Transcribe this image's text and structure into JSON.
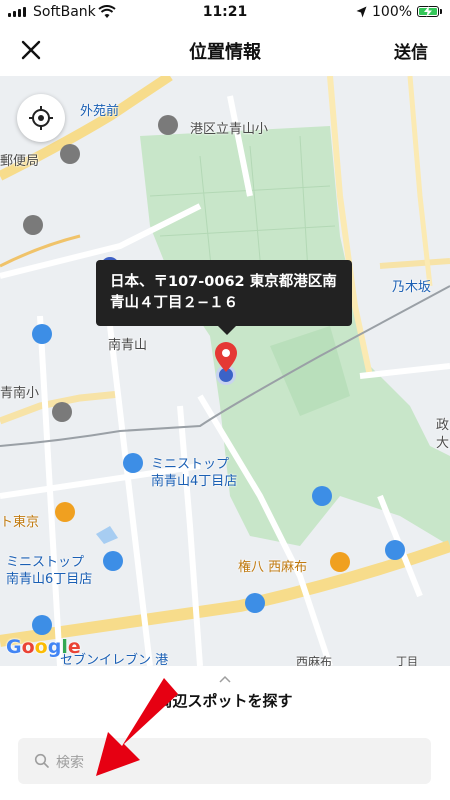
{
  "status_bar": {
    "carrier": "SoftBank",
    "time": "11:21",
    "battery": "100%"
  },
  "header": {
    "title": "位置情報",
    "send_label": "送信"
  },
  "map": {
    "address_callout": "日本、〒107-0062 東京都港区南青山４丁目２−１６",
    "labels": {
      "gaienmae": "外苑前",
      "minato_school": "港区立青山小",
      "post_office": "郵便局",
      "minami_aoyama": "南青山",
      "nogizaka": "乃木坂",
      "aoyama_school": "青南小",
      "east_side": "政",
      "east_side2": "大",
      "tokyo_left": "ト東京",
      "ministop1_line1": "ミニストップ",
      "ministop1_line2": "南青山4丁目店",
      "ministop2_line1": "ミニストップ",
      "ministop2_line2": "南青山6丁目店",
      "gonpachi": "権八 西麻布",
      "seven": "セブンイレブン 港",
      "nishiazabu": "西麻布",
      "chome": "丁目"
    },
    "google_logo": "Google"
  },
  "sheet": {
    "title": "周辺スポットを探す",
    "search_placeholder": "検索"
  },
  "colors": {
    "accent": "#e53935",
    "callout_bg": "#222222",
    "park": "#c8e6c9",
    "arrow": "#e60012"
  }
}
